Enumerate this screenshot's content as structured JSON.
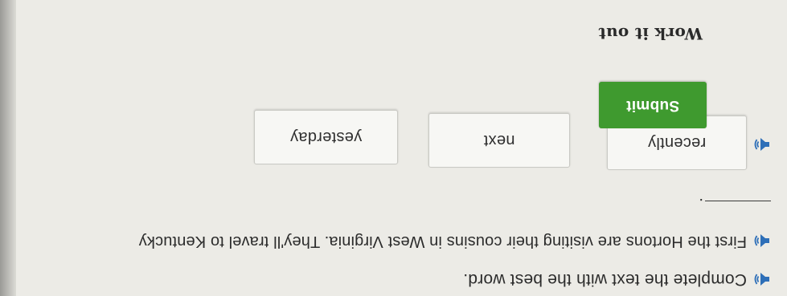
{
  "question": {
    "prompt": "Complete the text with the best word.",
    "sentence": "First the Hortons are visiting their cousins in West Virginia. They'll travel to Kentucky",
    "period": "."
  },
  "choices": [
    {
      "label": "recently"
    },
    {
      "label": "next"
    },
    {
      "label": "yesterday"
    }
  ],
  "actions": {
    "submit_label": "Submit",
    "work_it_out_label": "Work it out"
  },
  "icons": {
    "audio": "speaker-icon"
  },
  "colors": {
    "submit_bg": "#3f9a2f",
    "speaker_blue": "#2e6fb8"
  }
}
